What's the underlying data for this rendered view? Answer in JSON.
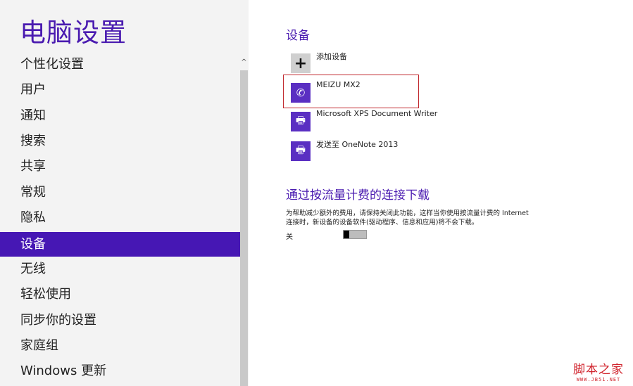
{
  "title": "电脑设置",
  "nav": [
    "个性化设置",
    "用户",
    "通知",
    "搜索",
    "共享",
    "常规",
    "隐私",
    "设备",
    "无线",
    "轻松使用",
    "同步你的设置",
    "家庭组",
    "Windows 更新"
  ],
  "selected_nav": "设备",
  "scroll_up": "^",
  "section_devices": "设备",
  "devices": [
    {
      "label": "添加设备",
      "icon": "+"
    },
    {
      "label": "MEIZU MX2",
      "icon": "✆"
    },
    {
      "label": "Microsoft XPS Document Writer",
      "icon": "🖶"
    },
    {
      "label": "发送至 OneNote 2013",
      "icon": "🖶"
    }
  ],
  "section_metered": "通过按流量计费的连接下载",
  "metered_desc_1": "为帮助减少额外的费用，请保持关闭此功能，这样当你使用按流量计费的 Internet",
  "metered_desc_2": "连接时，新设备的设备软件(驱动程序、信息和应用)将不会下载。",
  "toggle_state": "关",
  "watermark": {
    "line1": "脚本之家",
    "line2": "WWW.JB51.NET"
  },
  "colors": {
    "accent": "#4617b4",
    "highlight": "#c0282d"
  }
}
